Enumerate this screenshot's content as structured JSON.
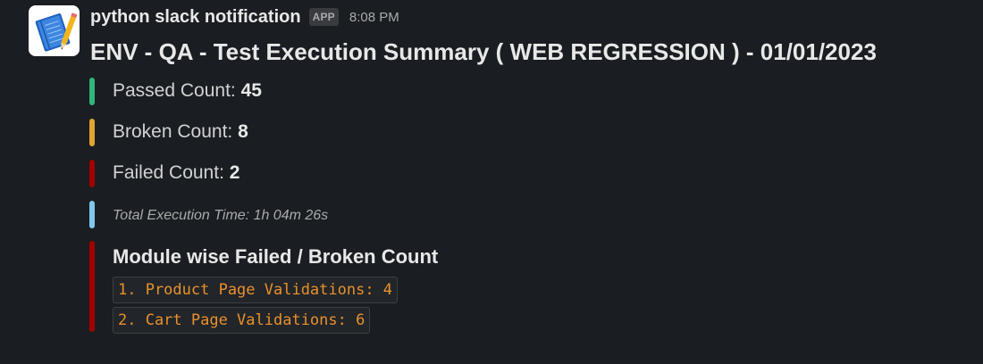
{
  "message": {
    "sender": "python slack notification",
    "app_badge": "APP",
    "timestamp": "8:08 PM",
    "avatar_icon": "notebook-pencil-icon",
    "title": "ENV - QA - Test Execution Summary ( WEB REGRESSION ) - 01/01/2023"
  },
  "attachments": {
    "passed": {
      "label": "Passed Count: ",
      "value": "45",
      "color": "#2eb67d"
    },
    "broken": {
      "label": "Broken Count: ",
      "value": "8",
      "color": "#e0a434"
    },
    "failed": {
      "label": "Failed Count: ",
      "value": "2",
      "color": "#a30200"
    },
    "execution_time": {
      "text": "Total Execution Time: 1h 04m 26s",
      "color": "#7fc8ec"
    },
    "module": {
      "title": "Module wise Failed / Broken Count",
      "color": "#a30200",
      "items": [
        "1. Product Page Validations: 4",
        "2. Cart Page Validations: 6"
      ]
    }
  },
  "colors": {
    "background": "#1a1d21",
    "text": "#d1d2d3",
    "code_text": "#e8912d"
  }
}
